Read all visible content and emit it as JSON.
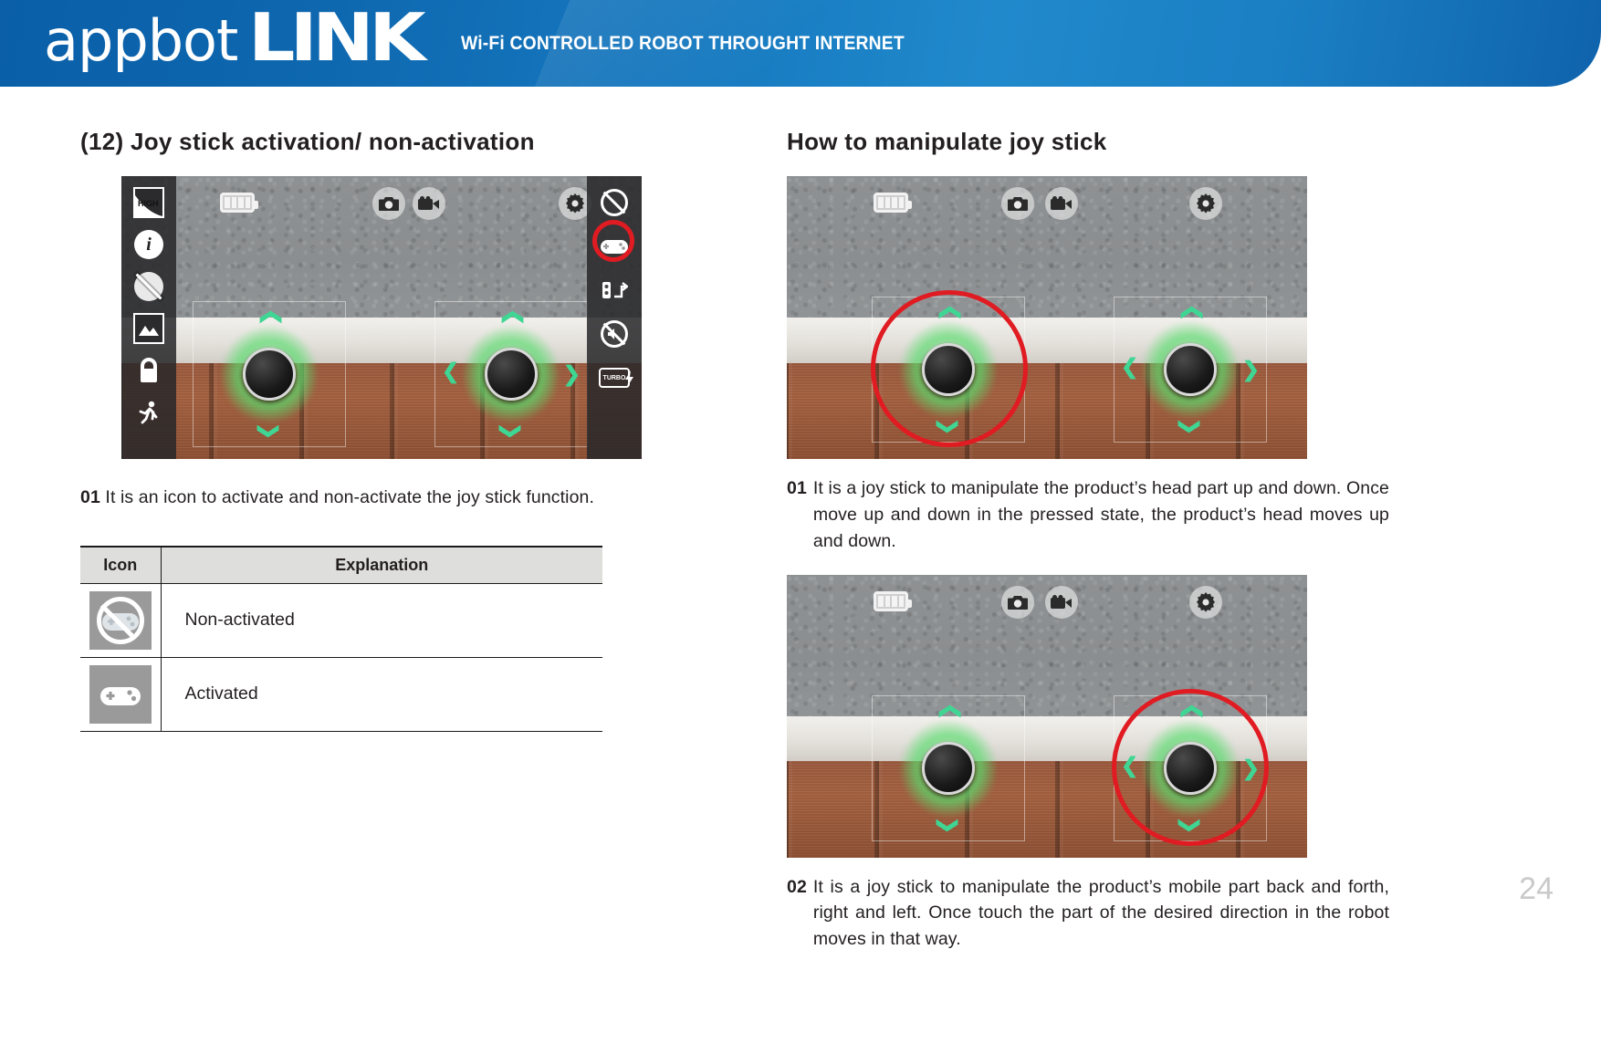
{
  "header": {
    "brand_primary": "appbot",
    "brand_secondary": "LINK",
    "tagline": "Wi-Fi CONTROLLED ROBOT THROUGHT INTERNET",
    "brand_color": "#1576bd"
  },
  "page_number": "24",
  "left_column": {
    "title": "(12) Joy stick activation/ non-activation",
    "screenshot": {
      "name": "appbot-link-camera-view",
      "left_sidebar_icons": [
        "hd-quality-icon",
        "info-icon",
        "no-photo-icon",
        "gallery-icon",
        "lock-icon",
        "run-icon"
      ],
      "right_sidebar_icons": [
        "no-signal-icon",
        "gamepad-icon",
        "robot-move-icon",
        "mute-icon",
        "speed-boost-icon"
      ],
      "top_icons": [
        "battery-icon",
        "camera-icon",
        "video-icon",
        "gear-icon"
      ],
      "highlighted_icon": "gamepad-icon",
      "highlight_color": "#e01b22",
      "joystick_arrows": [
        "up",
        "down",
        "left",
        "right"
      ],
      "joystick_glow_color": "#5adc6e"
    },
    "note": {
      "number": "01",
      "text": "It is an icon to activate and non-activate the joy stick function."
    },
    "table": {
      "headers": [
        "Icon",
        "Explanation"
      ],
      "rows": [
        {
          "icon": "gamepad-disabled-icon",
          "explanation": "Non-activated"
        },
        {
          "icon": "gamepad-icon",
          "explanation": "Activated"
        }
      ]
    }
  },
  "right_column": {
    "title": "How to manipulate joy stick",
    "screenshot_top": {
      "name": "appbot-link-camera-view-head-joystick",
      "top_icons": [
        "battery-icon",
        "camera-icon",
        "video-icon",
        "gear-icon"
      ],
      "highlighted_control": "left-joystick",
      "highlight_color": "#e01b22"
    },
    "note_top": {
      "number": "01",
      "text": "It is a joy stick to manipulate the product’s head part up and down. Once move up and down in the pressed state, the product’s head moves up and down."
    },
    "screenshot_bottom": {
      "name": "appbot-link-camera-view-move-joystick",
      "top_icons": [
        "battery-icon",
        "camera-icon",
        "video-icon",
        "gear-icon"
      ],
      "highlighted_control": "right-joystick",
      "highlight_color": "#e01b22"
    },
    "note_bottom": {
      "number": "02",
      "text": "It is a joy stick to manipulate the product’s mobile part back and forth, right and left. Once touch the part of the desired direction in the robot moves in that way."
    }
  }
}
